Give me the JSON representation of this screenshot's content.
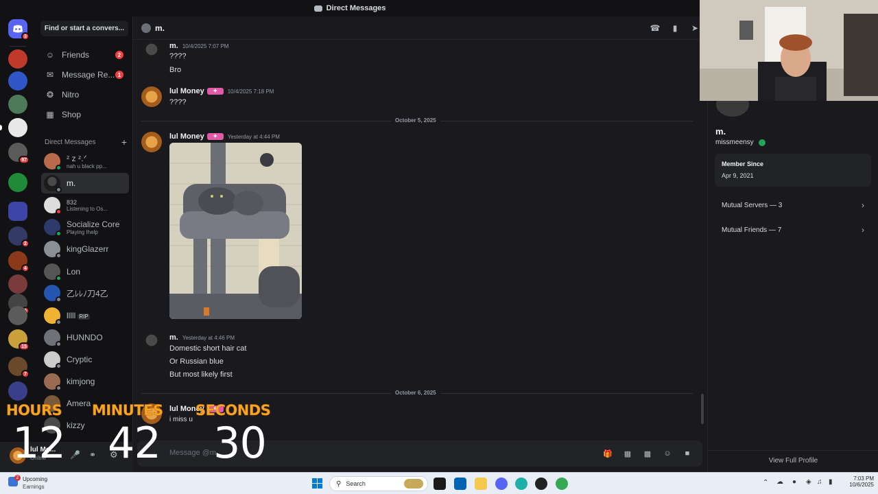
{
  "window": {
    "title": "Direct Messages"
  },
  "rail": {
    "badges": [
      "3",
      "97",
      "2",
      "4",
      "5",
      "15",
      "7"
    ]
  },
  "sidebar": {
    "search_label": "Find or start a convers...",
    "nav": [
      {
        "label": "Friends",
        "icon": "friends-icon",
        "badge": "2"
      },
      {
        "label": "Message Re...",
        "icon": "envelope-icon",
        "badge": "1"
      },
      {
        "label": "Nitro",
        "icon": "nitro-icon",
        "badge": ""
      },
      {
        "label": "Shop",
        "icon": "shop-icon",
        "badge": ""
      }
    ],
    "dm_header": "Direct Messages",
    "dms": [
      {
        "name": "ᶻ z ᶻ.ᐟ",
        "sub": "nah u black pp...",
        "status": "online"
      },
      {
        "name": "m.",
        "sub": "",
        "status": "offline",
        "active": true
      },
      {
        "name": "832",
        "sub": "Listening to Os...",
        "status": "dnd"
      },
      {
        "name": "Socialize Core",
        "sub": "Playing Ihelp",
        "status": "online"
      },
      {
        "name": "kingGlazerr",
        "sub": "",
        "status": "offline"
      },
      {
        "name": "Lon",
        "sub": "",
        "status": "online"
      },
      {
        "name": "乙ﾚﾚﾉ刀4乙",
        "sub": "",
        "status": "offline"
      },
      {
        "name": "lllll",
        "tag": "RIP",
        "sub": "",
        "status": "offline"
      },
      {
        "name": "HUNNDO",
        "sub": "",
        "status": "offline"
      },
      {
        "name": "Cryptic",
        "sub": "",
        "status": "offline"
      },
      {
        "name": "kimjong",
        "sub": "",
        "status": "offline"
      },
      {
        "name": "Amera",
        "sub": "",
        "status": "offline"
      },
      {
        "name": "kizzy",
        "sub": "",
        "status": "offline"
      }
    ],
    "user": {
      "name": "lul Mo...",
      "status": "Online"
    }
  },
  "chat": {
    "recipient": "m.",
    "messages": [
      {
        "author": "m.",
        "time": "10/4/2025 7:07 PM",
        "lines": [
          "????",
          "Bro"
        ]
      },
      {
        "author": "lul Money",
        "time": "10/4/2025 7:18 PM",
        "lines": [
          "????"
        ]
      },
      {
        "author": "lul Money",
        "time": "Yesterday at 4:44 PM",
        "lines": []
      },
      {
        "author": "m.",
        "time": "Yesterday at 4:46 PM",
        "lines": [
          "Domestic short hair cat",
          "Or Russian blue",
          "But most likely first"
        ]
      },
      {
        "author": "lul Money",
        "time": "",
        "lines": [
          "i miss u"
        ]
      }
    ],
    "dividers": [
      "October 5, 2025",
      "October 6, 2025"
    ],
    "composer_placeholder": "Message @m."
  },
  "profile": {
    "display_name": "m.",
    "username": "missmeensy",
    "member_since_label": "Member Since",
    "member_since": "Apr 9, 2021",
    "mutual_servers": "Mutual Servers — 3",
    "mutual_friends": "Mutual Friends — 7",
    "view_full": "View Full Profile"
  },
  "timer": {
    "hours_label": "HOURS",
    "minutes_label": "MINUTES",
    "seconds_label": "SECONDS",
    "hours": "12",
    "minutes": "42",
    "seconds": "30"
  },
  "taskbar": {
    "widget_count": "2",
    "widget_title": "Upcoming",
    "widget_sub": "Earnings",
    "search": "Search",
    "time": "7:03 PM",
    "date": "10/6/2025"
  }
}
